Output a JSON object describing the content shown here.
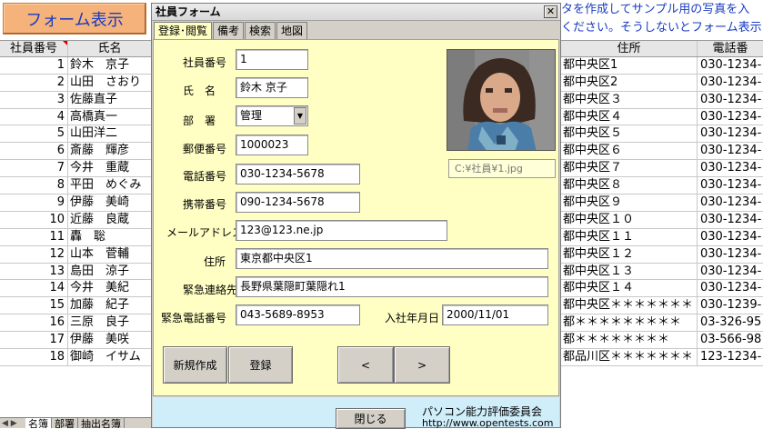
{
  "sheet": {
    "form_show_button": "フォーム表示",
    "top_note_lines": [
      "タを作成してサンプル用の写真を入",
      "ください。そうしないとフォーム表示"
    ],
    "headers": {
      "id": "社員番号",
      "name": "氏名",
      "address": "住所",
      "tel": "電話番"
    },
    "rows": [
      {
        "id": "1",
        "name": "鈴木　京子",
        "address": "都中央区1",
        "tel": "030-1234-"
      },
      {
        "id": "2",
        "name": "山田　さおり",
        "address": "都中央区2",
        "tel": "030-1234-"
      },
      {
        "id": "3",
        "name": "佐藤直子",
        "address": "都中央区３",
        "tel": "030-1234-"
      },
      {
        "id": "4",
        "name": "高橋真一",
        "address": "都中央区４",
        "tel": "030-1234-"
      },
      {
        "id": "5",
        "name": "山田洋二",
        "address": "都中央区５",
        "tel": "030-1234-"
      },
      {
        "id": "6",
        "name": "斎藤　輝彦",
        "address": "都中央区６",
        "tel": "030-1234-"
      },
      {
        "id": "7",
        "name": "今井　重蔵",
        "address": "都中央区７",
        "tel": "030-1234-"
      },
      {
        "id": "8",
        "name": "平田　めぐみ",
        "address": "都中央区８",
        "tel": "030-1234-"
      },
      {
        "id": "9",
        "name": "伊藤　美崎",
        "address": "都中央区９",
        "tel": "030-1234-"
      },
      {
        "id": "10",
        "name": "近藤　良蔵",
        "address": "都中央区１０",
        "tel": "030-1234-"
      },
      {
        "id": "11",
        "name": "轟　聡",
        "address": "都中央区１１",
        "tel": "030-1234-"
      },
      {
        "id": "12",
        "name": "山本　菅輔",
        "address": "都中央区１２",
        "tel": "030-1234-"
      },
      {
        "id": "13",
        "name": "島田　涼子",
        "address": "都中央区１３",
        "tel": "030-1234-"
      },
      {
        "id": "14",
        "name": "今井　美紀",
        "address": "都中央区１４",
        "tel": "030-1234-"
      },
      {
        "id": "15",
        "name": "加藤　紀子",
        "address": "都中央区＊＊＊＊＊＊＊",
        "tel": "030-1239-"
      },
      {
        "id": "16",
        "name": "三原　良子",
        "address": "都＊＊＊＊＊＊＊＊＊",
        "tel": "03-326-95"
      },
      {
        "id": "17",
        "name": "伊藤　美咲",
        "address": "都＊＊＊＊＊＊＊＊",
        "tel": "03-566-98"
      },
      {
        "id": "18",
        "name": "御崎　イサム",
        "address": "都品川区＊＊＊＊＊＊＊",
        "tel": "123-1234-"
      }
    ],
    "tabs": {
      "nav": "◀ ▶",
      "items": [
        "名簿",
        "部署",
        "抽出名簿"
      ]
    }
  },
  "form": {
    "title": "社員フォーム",
    "close_glyph": "✕",
    "tabs": [
      "登録･閲覧",
      "備考",
      "検索",
      "地図"
    ],
    "labels": {
      "id": "社員番号",
      "name": "氏　名",
      "dept": "部　署",
      "zip": "郵便番号",
      "tel": "電話番号",
      "mobile": "携帯番号",
      "mail": "メールアドレス",
      "address": "住所",
      "emergency": "緊急連絡先",
      "emergency_tel": "緊急電話番号",
      "join_date": "入社年月日"
    },
    "values": {
      "id": "1",
      "name": "鈴木 京子",
      "dept": "管理",
      "zip": "1000023",
      "tel": "030-1234-5678",
      "mobile": "090-1234-5678",
      "mail": "123@123.ne.jp",
      "address": "東京都中央区1",
      "emergency": "長野県葉隠町葉隠れ1",
      "emergency_tel": "043-5689-8953",
      "join_date": "2000/11/01"
    },
    "photo_path": "C:¥社員¥1.jpg",
    "dropdown_glyph": "▼",
    "buttons": {
      "new": "新規作成",
      "register": "登録",
      "prev": "<",
      "next": ">",
      "close": "閉じる"
    },
    "footer": {
      "org": "パソコン能力評価委員会",
      "url": "http://www.opentests.com"
    }
  }
}
